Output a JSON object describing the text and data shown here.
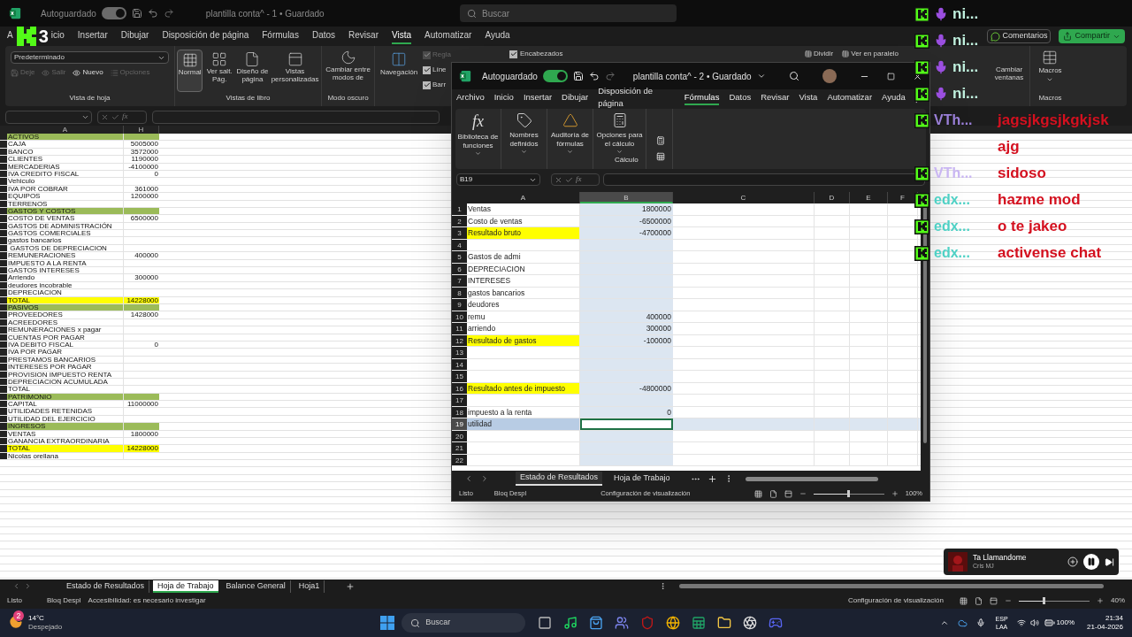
{
  "bg_window": {
    "autosave_label": "Autoguardado",
    "autosave_on": true,
    "title": "plantilla conta^ - 1 • Guardado",
    "search": {
      "placeholder": "Buscar"
    },
    "menu": [
      {
        "label": "A",
        "selected": false
      },
      {
        "label": "icio",
        "selected": false
      },
      {
        "label": "Insertar",
        "selected": false
      },
      {
        "label": "Dibujar",
        "selected": false
      },
      {
        "label": "Disposición de página",
        "selected": false
      },
      {
        "label": "Fórmulas",
        "selected": false
      },
      {
        "label": "Datos",
        "selected": false
      },
      {
        "label": "Revisar",
        "selected": false
      },
      {
        "label": "Vista",
        "selected": true
      },
      {
        "label": "Automatizar",
        "selected": false
      },
      {
        "label": "Ayuda",
        "selected": false
      }
    ],
    "overlay_badge": "3",
    "comments_button": "Comentarios",
    "share_button": "Compartir",
    "ribbon": {
      "view_select": "Predeterminado",
      "sheet_view_buttons": [
        {
          "label": "Deje",
          "disabled": true
        },
        {
          "label": "Salir",
          "disabled": true
        },
        {
          "label": "Nuevo",
          "disabled": false
        },
        {
          "label": "Opciones",
          "disabled": true
        }
      ],
      "sheet_view_group": "Vista de hoja",
      "workbook_views": [
        {
          "label": "Normal",
          "selected": true
        },
        {
          "label": "Ver salt. Pág.",
          "selected": false
        },
        {
          "label": "Diseño de página",
          "selected": false
        },
        {
          "label": "Vistas personalizadas",
          "selected": false
        }
      ],
      "workbook_group": "Vistas de libro",
      "dark_mode_button": "Cambiar entre modos de",
      "dark_mode_group": "Modo oscuro",
      "navigation_button": "Navegación",
      "checkboxes": [
        {
          "label": "Regla",
          "checked": true,
          "disabled": true
        },
        {
          "label": "Líne",
          "checked": true,
          "disabled": false
        },
        {
          "label": "Barr",
          "checked": true,
          "disabled": false
        }
      ],
      "headings_checkbox": {
        "label": "Encabezados",
        "checked": true
      },
      "window_buttons": [
        "Dividir",
        "Ver en paralelo"
      ],
      "switch_windows_button": "Cambiar ventanas",
      "macros_button": "Macros",
      "macros_group": "Macros"
    },
    "columns": [
      "A",
      "H"
    ],
    "rows": [
      {
        "a": "ACTIVOS",
        "color": "#9bbb59"
      },
      {
        "a": "CAJA",
        "h": "5005000"
      },
      {
        "a": "BANCO",
        "h": "3572000"
      },
      {
        "a": "CLIENTES",
        "h": "1190000"
      },
      {
        "a": "MERCADERIAS",
        "h": "-4100000"
      },
      {
        "a": "IVA CREDITO FISCAL",
        "h": "0"
      },
      {
        "a": "Vehiculo"
      },
      {
        "a": "IVA POR COBRAR",
        "h": "361000"
      },
      {
        "a": "EQUIPOS",
        "h": "1200000"
      },
      {
        "a": "TERRENOS"
      },
      {
        "a": "GASTOS Y COSTOS",
        "color": "#9bbb59"
      },
      {
        "a": "COSTO DE VENTAS",
        "h": "6500000"
      },
      {
        "a": "GASTOS DE ADMINISTRACIÓN"
      },
      {
        "a": "GASTOS COMERCIALES"
      },
      {
        "a": "gastos bancarios"
      },
      {
        "a": " GASTOS DE DEPRECIACION"
      },
      {
        "a": "REMUNERACIONES",
        "h": "400000"
      },
      {
        "a": "IMPUESTO A LA RENTA"
      },
      {
        "a": "GASTOS INTERESES"
      },
      {
        "a": "Arriendo",
        "h": "300000"
      },
      {
        "a": "deudores incobrable"
      },
      {
        "a": "DEPRECIACION"
      },
      {
        "a": "TOTAL",
        "h": "14228000",
        "color": "#ffff00"
      },
      {
        "a": "PASIVOS",
        "color": "#9bbb59"
      },
      {
        "a": "PROVEEDORES",
        "h": "1428000"
      },
      {
        "a": "ACREEDORES"
      },
      {
        "a": "REMUNERACIONES x pagar"
      },
      {
        "a": "CUENTAS POR PAGAR"
      },
      {
        "a": "IVA DEBITO FISCAL",
        "h": "0"
      },
      {
        "a": "IVA POR PAGAR"
      },
      {
        "a": "PRESTAMOS BANCARIOS"
      },
      {
        "a": "INTERESES POR PAGAR"
      },
      {
        "a": "PROVISION IMPUESTO RENTA"
      },
      {
        "a": "DEPRECIACION ACUMULADA"
      },
      {
        "a": "TOTAL"
      },
      {
        "a": "PATRIMONIO",
        "color": "#9bbb59"
      },
      {
        "a": "CAPITAL",
        "h": "11000000"
      },
      {
        "a": "UTILIDADES RETENIDAS"
      },
      {
        "a": "UTILIDAD DEL EJERCICIO"
      },
      {
        "a": "INGRESOS",
        "color": "#9bbb59"
      },
      {
        "a": "VENTAS",
        "h": "1800000"
      },
      {
        "a": "GANANCIA EXTRAORDINARIA"
      },
      {
        "a": "TOTAL",
        "h": "14228000",
        "color": "#ffff00"
      },
      {
        "a": "Nicolas orellana"
      }
    ],
    "sheet_tabs": [
      {
        "label": "Estado de Resultados",
        "selected": false
      },
      {
        "label": "Hoja de Trabajo",
        "selected": true
      },
      {
        "label": "Balance General",
        "selected": false
      },
      {
        "label": "Hoja1",
        "selected": false
      }
    ],
    "status": {
      "ready": "Listo",
      "scroll_lock": "Bloq Despl",
      "accessibility": "Accesibilidad: es necesario investigar",
      "display_settings": "Configuración de visualización",
      "zoom": "40%",
      "zoom_slider": {
        "level": 0.35
      }
    },
    "formula_symbol": "fx"
  },
  "fg_window": {
    "autosave_label": "Autoguardado",
    "autosave_on": true,
    "title": "plantilla conta^ - 2 • Guardado",
    "menu": [
      {
        "label": "Archivo",
        "selected": false
      },
      {
        "label": "Inicio",
        "selected": false
      },
      {
        "label": "Insertar",
        "selected": false
      },
      {
        "label": "Dibujar",
        "selected": false
      },
      {
        "label": "Disposición de página",
        "selected": false
      },
      {
        "label": "Fórmulas",
        "selected": true
      },
      {
        "label": "Datos",
        "selected": false
      },
      {
        "label": "Revisar",
        "selected": false
      },
      {
        "label": "Vista",
        "selected": false
      },
      {
        "label": "Automatizar",
        "selected": false
      },
      {
        "label": "Ayuda",
        "selected": false
      }
    ],
    "ribbon": [
      {
        "kind": "fx",
        "symbol": "fx",
        "label": "Biblioteca de funciones"
      },
      {
        "kind": "tag",
        "label": "Nombres definidos"
      },
      {
        "kind": "audit",
        "label": "Auditoría de fórmulas"
      },
      {
        "kind": "calc",
        "label": "Opciones para el cálculo"
      }
    ],
    "calc_group": "Cálculo",
    "name_box": "B19",
    "columns": [
      {
        "label": "A",
        "selected": false
      },
      {
        "label": "B",
        "selected": true
      },
      {
        "label": "C",
        "selected": false
      },
      {
        "label": "D",
        "selected": false
      },
      {
        "label": "E",
        "selected": false
      },
      {
        "label": "F",
        "selected": false
      }
    ],
    "rows": [
      {
        "n": "1",
        "a": "Ventas",
        "b": "1800000",
        "selected": false
      },
      {
        "n": "2",
        "a": "Costo de ventas",
        "b": "-6500000",
        "selected": false
      },
      {
        "n": "3",
        "a": "Resultado bruto",
        "b": "-4700000",
        "color": "#ffff00",
        "selected": false
      },
      {
        "n": "4",
        "selected": false
      },
      {
        "n": "5",
        "a": "Gastos de admi",
        "selected": false
      },
      {
        "n": "6",
        "a": "DEPRECIACION",
        "selected": false
      },
      {
        "n": "7",
        "a": "INTERESES",
        "selected": false
      },
      {
        "n": "8",
        "a": "gastos bancarios",
        "selected": false
      },
      {
        "n": "9",
        "a": "deudores",
        "selected": false
      },
      {
        "n": "10",
        "a": "remu",
        "b": "400000",
        "selected": false
      },
      {
        "n": "11",
        "a": "arriendo",
        "b": "300000",
        "selected": false
      },
      {
        "n": "12",
        "a": "Resultado de gastos",
        "b": "-100000",
        "color": "#ffff00",
        "selected": false
      },
      {
        "n": "13",
        "selected": false
      },
      {
        "n": "14",
        "selected": false
      },
      {
        "n": "15",
        "selected": false
      },
      {
        "n": "16",
        "a": "Resultado antes de impuesto",
        "b": "-4800000",
        "color": "#ffff00",
        "selected": false
      },
      {
        "n": "17",
        "selected": false
      },
      {
        "n": "18",
        "a": "impuesto a la renta",
        "b": "0",
        "selected": false
      },
      {
        "n": "19",
        "a": "utilidad",
        "selected": true
      },
      {
        "n": "20",
        "selected": false
      },
      {
        "n": "21",
        "selected": false
      },
      {
        "n": "22",
        "selected": false
      }
    ],
    "sheet_tabs": [
      {
        "label": "Estado de Resultados",
        "selected": true
      },
      {
        "label": "Hoja de Trabajo",
        "selected": false
      }
    ],
    "status": {
      "ready": "Listo",
      "scroll_lock": "Bloq Despl",
      "display_settings": "Configuración de visualización",
      "zoom": "100%",
      "zoom_slider": {
        "level": 0.5
      }
    },
    "formula_symbol": "fx"
  },
  "chat": [
    {
      "kind": "voice",
      "user": "ni..."
    },
    {
      "kind": "voice",
      "user": "ni..."
    },
    {
      "kind": "voice",
      "user": "ni..."
    },
    {
      "kind": "voice",
      "user": "ni..."
    },
    {
      "kind": "message",
      "badge": true,
      "user": "VTh...",
      "color": "#9a7fd8",
      "message": "jagsjkgsjkgkjsk"
    },
    {
      "kind": "message",
      "badge": false,
      "message": "ajg"
    },
    {
      "kind": "message",
      "badge": true,
      "user": "VTh...",
      "color": "#c9b6f2",
      "message": "sidoso"
    },
    {
      "kind": "message",
      "badge": true,
      "user": "edx...",
      "color": "#4fd1c5",
      "message": "hazme mod"
    },
    {
      "kind": "message",
      "badge": true,
      "user": "edx...",
      "color": "#4fd1c5",
      "message": "o te jakeo"
    },
    {
      "kind": "message",
      "badge": true,
      "user": "edx...",
      "color": "#4fd1c5",
      "message": "activense chat"
    }
  ],
  "media": {
    "title": "Ta Llamandome",
    "artist": "Cris MJ",
    "playing": true
  },
  "taskbar": {
    "weather_badge": "2",
    "temperature": "14°C",
    "weather": "Despejado",
    "search": {
      "placeholder": "Buscar"
    },
    "language": "ESP",
    "layout": "LAA",
    "battery": "100%",
    "time": "21:34",
    "date": "21-04-2026"
  }
}
